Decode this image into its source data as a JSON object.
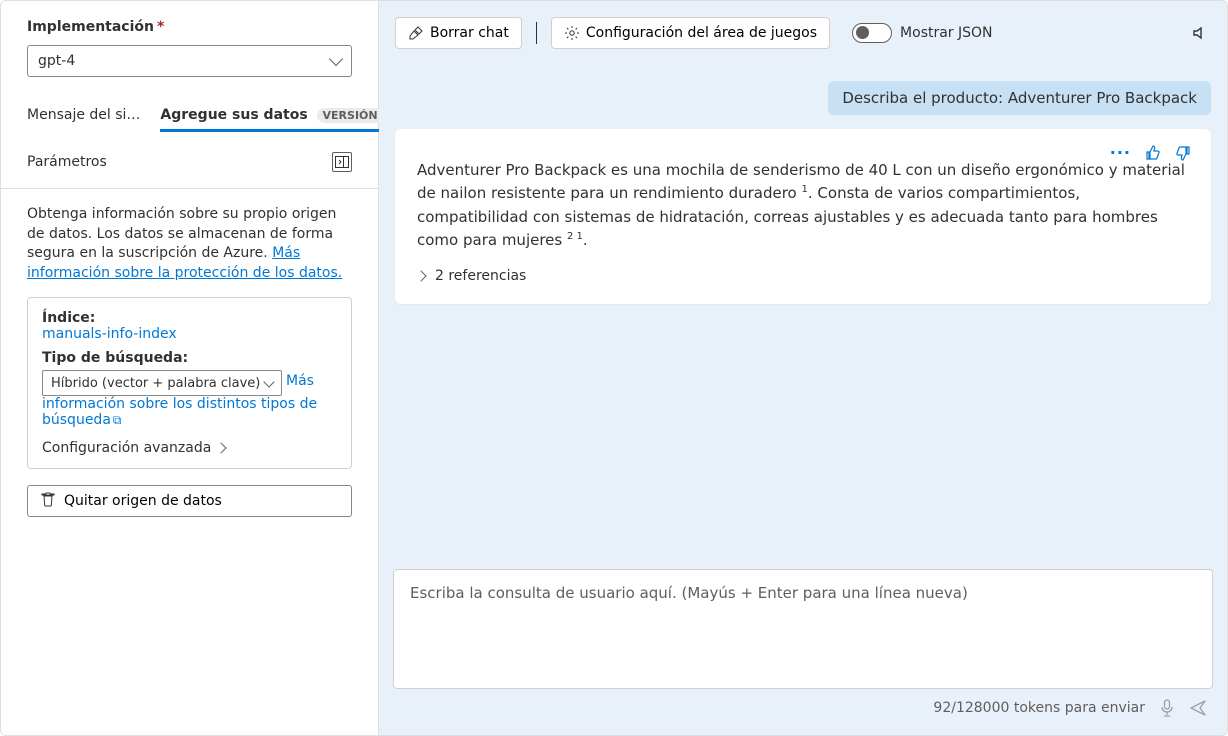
{
  "left": {
    "deployment_label": "Implementación",
    "deployment_value": "gpt-4",
    "tabs": {
      "system": "Mensaje del si…",
      "add_data": "Agregue sus datos",
      "badge": "VERSIÓN PREL…"
    },
    "parameters_label": "Parámetros",
    "info_text_1": "Obtenga información sobre su propio origen de datos. Los datos se almacenan de forma segura en la suscripción de Azure. ",
    "info_link": "Más información sobre la protección de los datos.",
    "index_label": "Índice:",
    "index_value": "manuals-info-index",
    "search_type_label": "Tipo de búsqueda:",
    "search_type_value": "Híbrido (vector + palabra clave)",
    "more_search_link_1": "Más ",
    "more_search_link_2": "información sobre los distintos tipos de búsqueda",
    "advanced_label": "Configuración avanzada",
    "remove_label": "Quitar origen de datos"
  },
  "toolbar": {
    "clear_chat": "Borrar chat",
    "playground_settings": "Configuración del área de juegos",
    "show_json": "Mostrar JSON"
  },
  "chat": {
    "user_message": "Describa el producto: Adventurer Pro Backpack",
    "assistant_message_p1": "Adventurer Pro Backpack es una mochila de senderismo de 40 L con un diseño ergonómico y material de nailon resistente para un rendimiento duradero ",
    "assistant_cite1": "1",
    "assistant_message_p2": ". Consta de varios compartimientos, compatibilidad con sistemas de hidratación, correas ajustables y es adecuada tanto para hombres como para mujeres ",
    "assistant_cite2": "2 1",
    "assistant_message_p3": ".",
    "references_label": "2 referencias"
  },
  "input": {
    "placeholder": "Escriba la consulta de usuario aquí. (Mayús + Enter para una línea nueva)",
    "token_status": "92/128000 tokens para enviar"
  }
}
